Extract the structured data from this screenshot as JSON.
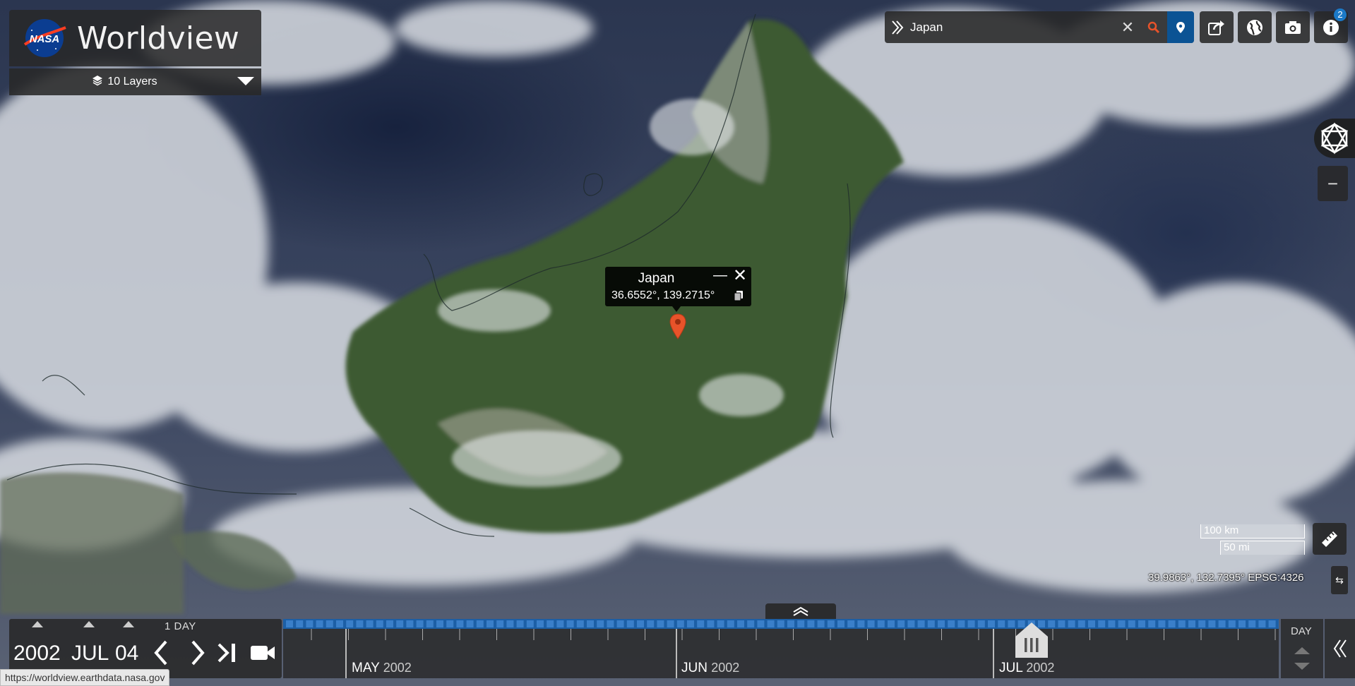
{
  "app": {
    "brand": "Worldview",
    "logo": "NASA"
  },
  "layers": {
    "label": "10 Layers"
  },
  "search": {
    "value": "Japan"
  },
  "toolbar": {
    "info_badge": "2"
  },
  "popup": {
    "title": "Japan",
    "coordinates": "36.6552°, 139.2715°"
  },
  "scale": {
    "km": "100 km",
    "mi": "50 mi"
  },
  "cursor": {
    "coordinates": "39.9863°, 132.7395°",
    "projection": "EPSG:4326"
  },
  "date": {
    "year": "2002",
    "month": "JUL",
    "day": "04",
    "interval": "1 DAY"
  },
  "timeline": {
    "months": [
      {
        "name": "MAY",
        "year": "2002"
      },
      {
        "name": "JUN",
        "year": "2002"
      },
      {
        "name": "JUL",
        "year": "2002"
      }
    ],
    "zoom_level": "DAY"
  },
  "statusbar": {
    "url": "https://worldview.earthdata.nasa.gov"
  },
  "colors": {
    "accent": "#1c5fa6",
    "pin_button": "#0b5394",
    "marker": "#e8532a",
    "panel": "#282828"
  }
}
